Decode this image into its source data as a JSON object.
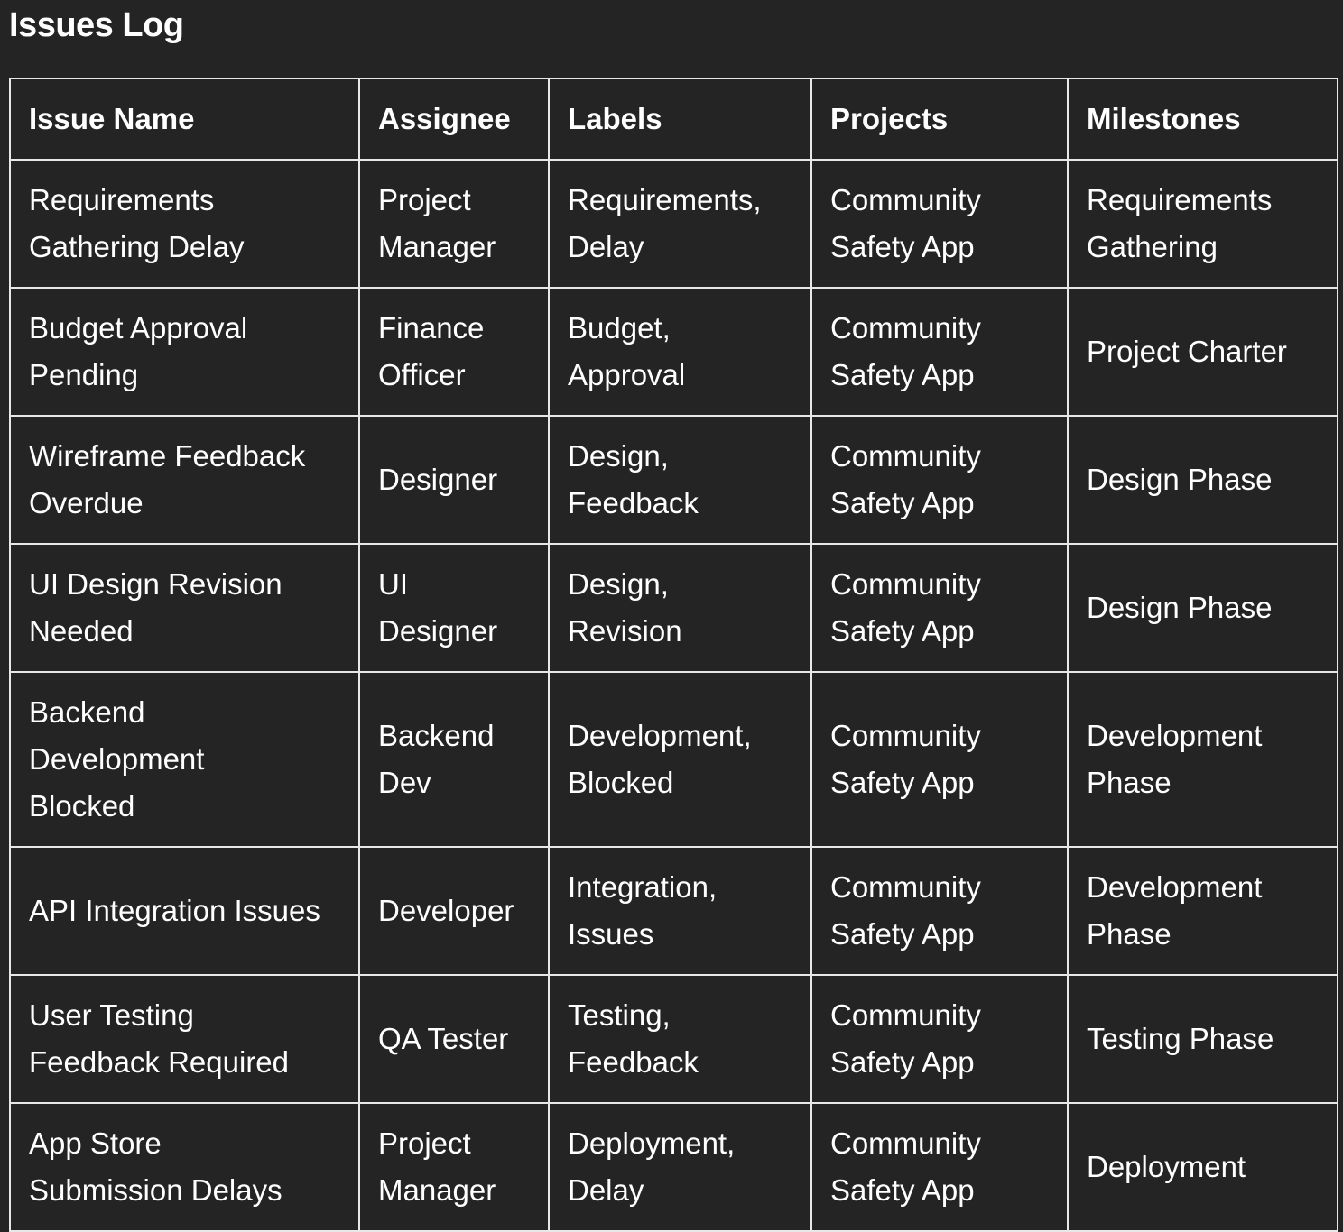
{
  "page": {
    "title": "Issues Log"
  },
  "table": {
    "columns": [
      "Issue Name",
      "Assignee",
      "Labels",
      "Projects",
      "Milestones"
    ],
    "rows": [
      {
        "issue_name": [
          "Requirements",
          "Gathering Delay"
        ],
        "assignee": [
          "Project",
          "Manager"
        ],
        "labels": [
          "Requirements,",
          "Delay"
        ],
        "project": [
          "Community",
          "Safety App"
        ],
        "milestone": [
          "Requirements",
          "Gathering"
        ]
      },
      {
        "issue_name": [
          "Budget Approval",
          "Pending"
        ],
        "assignee": [
          "Finance",
          "Officer"
        ],
        "labels": [
          "Budget,",
          "Approval"
        ],
        "project": [
          "Community",
          "Safety App"
        ],
        "milestone": [
          "Project Charter"
        ]
      },
      {
        "issue_name": [
          "Wireframe Feedback",
          "Overdue"
        ],
        "assignee": [
          "Designer"
        ],
        "labels": [
          "Design,",
          "Feedback"
        ],
        "project": [
          "Community",
          "Safety App"
        ],
        "milestone": [
          "Design Phase"
        ]
      },
      {
        "issue_name": [
          "UI Design Revision",
          "Needed"
        ],
        "assignee": [
          "UI",
          "Designer"
        ],
        "labels": [
          "Design,",
          "Revision"
        ],
        "project": [
          "Community",
          "Safety App"
        ],
        "milestone": [
          "Design Phase"
        ]
      },
      {
        "issue_name": [
          "Backend",
          "Development",
          "Blocked"
        ],
        "assignee": [
          "Backend",
          "Dev"
        ],
        "labels": [
          "Development,",
          "Blocked"
        ],
        "project": [
          "Community",
          "Safety App"
        ],
        "milestone": [
          "Development",
          "Phase"
        ]
      },
      {
        "issue_name": [
          "API Integration Issues"
        ],
        "assignee": [
          "Developer"
        ],
        "labels": [
          "Integration,",
          "Issues"
        ],
        "project": [
          "Community",
          "Safety App"
        ],
        "milestone": [
          "Development",
          "Phase"
        ]
      },
      {
        "issue_name": [
          "User Testing",
          "Feedback Required"
        ],
        "assignee": [
          "QA Tester"
        ],
        "labels": [
          "Testing,",
          "Feedback"
        ],
        "project": [
          "Community",
          "Safety App"
        ],
        "milestone": [
          "Testing Phase"
        ]
      },
      {
        "issue_name": [
          "App Store",
          "Submission Delays"
        ],
        "assignee": [
          "Project",
          "Manager"
        ],
        "labels": [
          "Deployment,",
          "Delay"
        ],
        "project": [
          "Community",
          "Safety App"
        ],
        "milestone": [
          "Deployment"
        ]
      }
    ]
  }
}
